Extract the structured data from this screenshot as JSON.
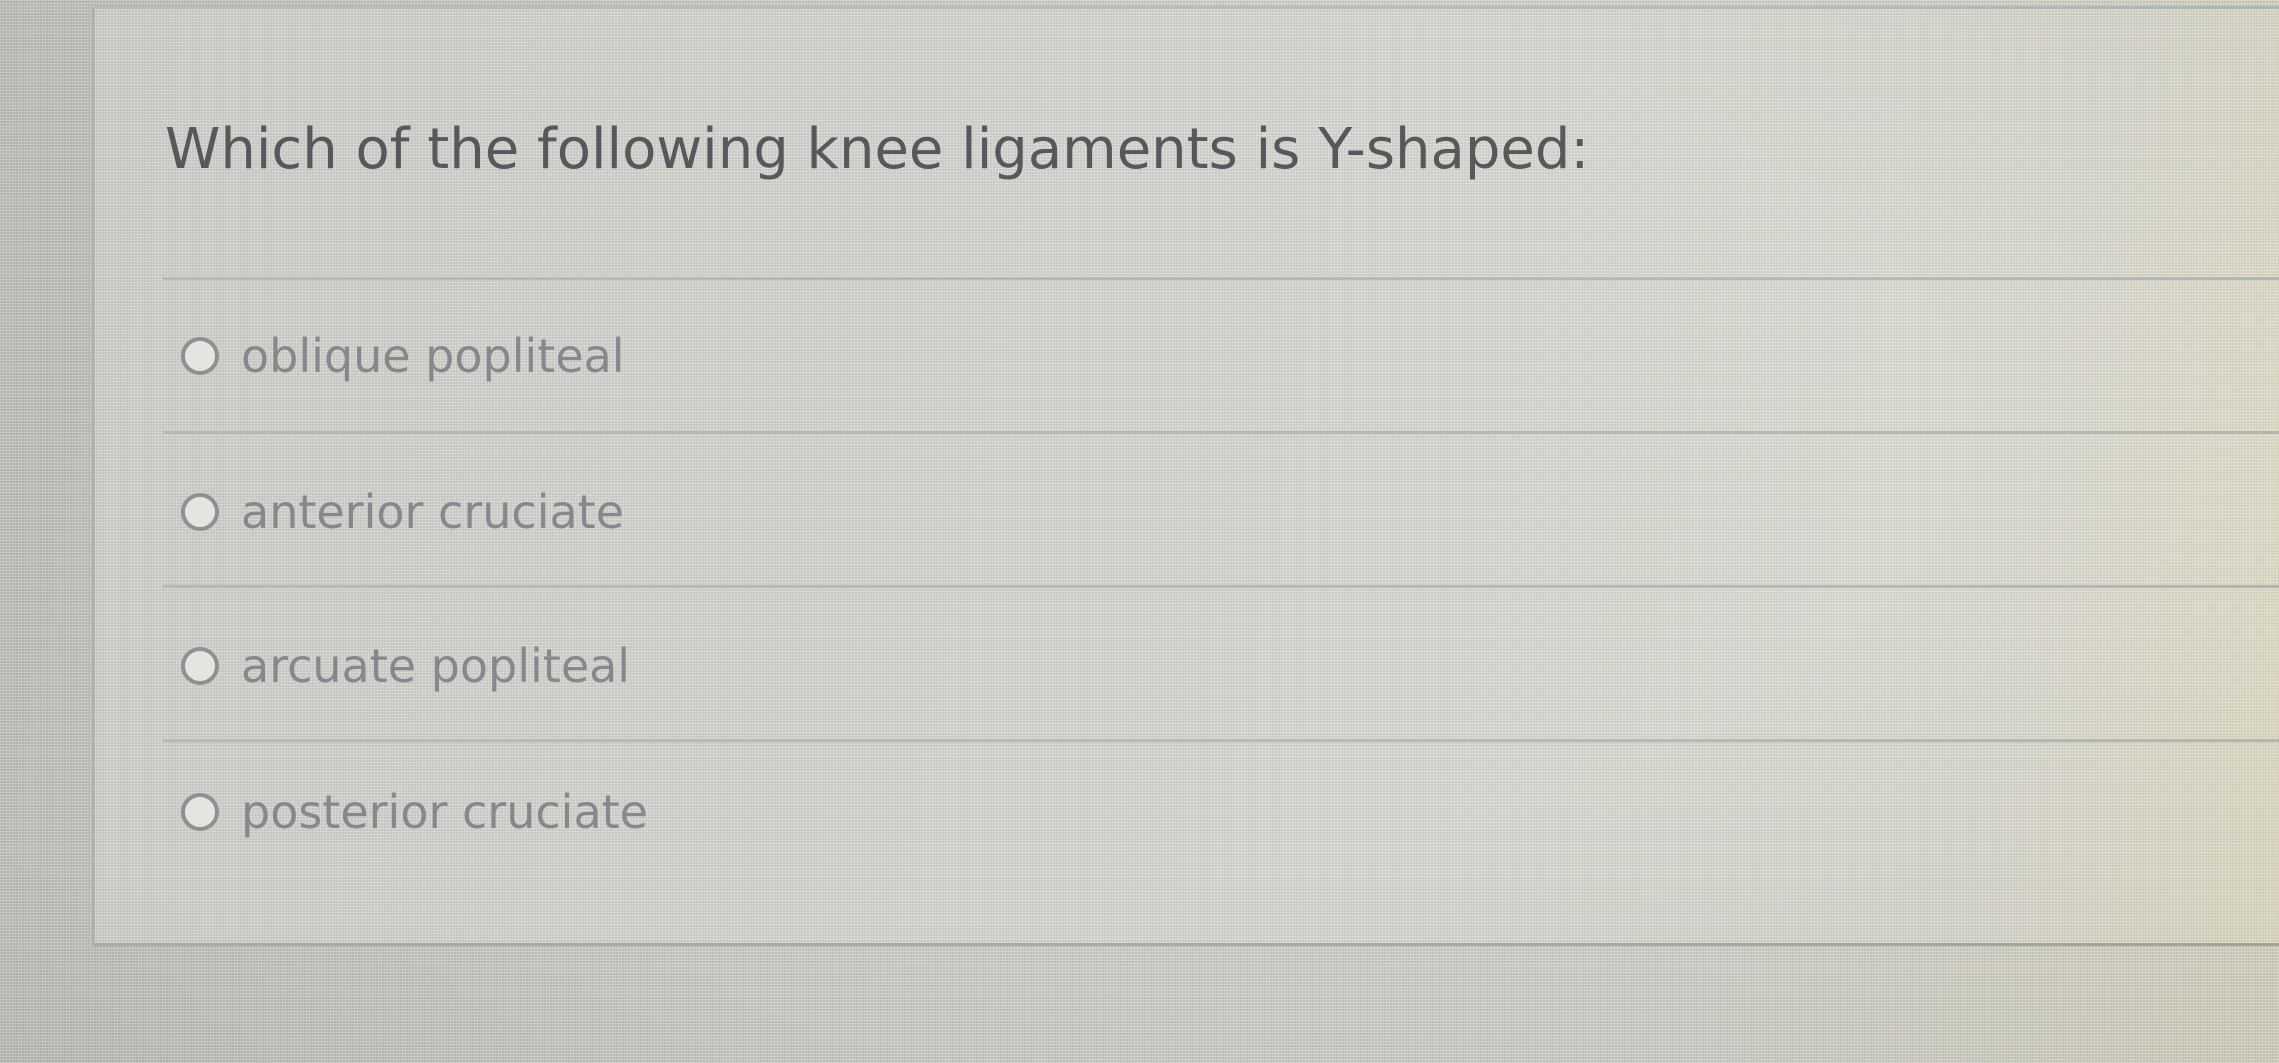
{
  "question": {
    "text": "Which of the following knee ligaments is Y-shaped:"
  },
  "options": [
    {
      "label": "oblique popliteal",
      "selected": false
    },
    {
      "label": "anterior cruciate",
      "selected": false
    },
    {
      "label": "arcuate popliteal",
      "selected": false
    },
    {
      "label": "posterior cruciate",
      "selected": false
    }
  ]
}
